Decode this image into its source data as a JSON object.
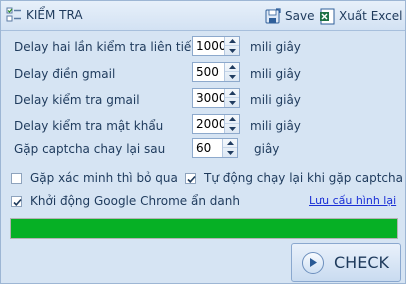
{
  "header": {
    "title": "KIỂM TRA",
    "save_label": "Save",
    "export_label": "Xuất Excel"
  },
  "settings": [
    {
      "label": "Delay hai lần kiểm tra liên tiếp",
      "value": "1000",
      "unit": "mili giây"
    },
    {
      "label": "Delay điền gmail",
      "value": "500",
      "unit": "mili giây"
    },
    {
      "label": "Delay kiểm tra gmail",
      "value": "3000",
      "unit": "mili giây"
    },
    {
      "label": "Delay kiểm tra mật khẩu",
      "value": "2000",
      "unit": "mili giây"
    },
    {
      "label": "Gặp captcha chay lại sau",
      "value": "60",
      "unit": "giây"
    }
  ],
  "options": {
    "skip_verify": {
      "label": "Gặp xác minh thì bỏ qua",
      "checked": false
    },
    "auto_rerun": {
      "label": "Tự động chạy lại khi gặp captcha",
      "checked": true
    },
    "incognito": {
      "label": "Khởi động Google Chrome ẩn danh",
      "checked": true
    }
  },
  "save_config_link": "Lưu cấu hình lại",
  "progress": {
    "percent": 100,
    "color": "#06b025"
  },
  "check_button_label": "CHECK"
}
